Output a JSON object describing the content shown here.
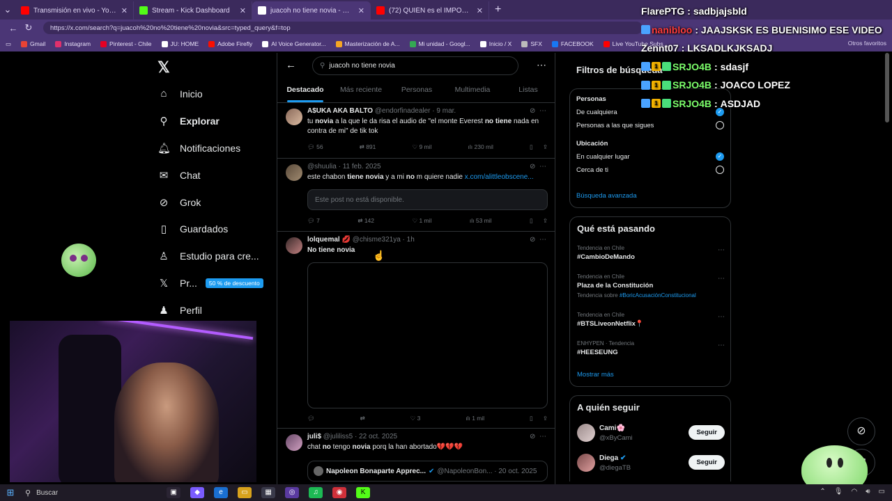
{
  "browser": {
    "tabs": [
      {
        "label": "Transmisión en vivo - YouTube Stu",
        "color": "#ff0000",
        "active": false
      },
      {
        "label": "Stream - Kick Dashboard",
        "color": "#53fc18",
        "active": false
      },
      {
        "label": "juacoh no tiene novia - Buscar / X",
        "color": "#ffffff",
        "active": true
      },
      {
        "label": "(72) QUIÉN es el IMPOSTOR en Mi",
        "color": "#ff0000",
        "active": false
      }
    ],
    "new_tab": "+",
    "url": "https://x.com/search?q=juacoh%20no%20tiene%20novia&src=typed_query&f=top",
    "bookmarks": [
      {
        "label": "Gmail",
        "color": "#ea4335"
      },
      {
        "label": "Instagram",
        "color": "#e1306c"
      },
      {
        "label": "Pinterest - Chile",
        "color": "#e60023"
      },
      {
        "label": "JU: HOME",
        "color": "#ffffff"
      },
      {
        "label": "Adobe Firefly",
        "color": "#fa0f00"
      },
      {
        "label": "AI Voice Generator...",
        "color": "#ffffff"
      },
      {
        "label": "Masterización de A...",
        "color": "#f5a623"
      },
      {
        "label": "Mi unidad - Googl...",
        "color": "#34a853"
      },
      {
        "label": "Inicio / X",
        "color": "#ffffff"
      },
      {
        "label": "SFX",
        "color": "#bbbbbb"
      },
      {
        "label": "FACEBOOK",
        "color": "#1877f2"
      },
      {
        "label": "Live YouTube Subs...",
        "color": "#ff0000"
      }
    ],
    "other_bookmarks": "Otros favoritos"
  },
  "nav": {
    "logo": "𝕏",
    "items": [
      {
        "label": "Inicio",
        "icon": "home-icon",
        "glyph": "⌂",
        "bold": false
      },
      {
        "label": "Explorar",
        "icon": "search-icon",
        "glyph": "⚲",
        "bold": true
      },
      {
        "label": "Notificaciones",
        "icon": "bell-icon",
        "glyph": "🔔︎",
        "bold": false
      },
      {
        "label": "Chat",
        "icon": "mail-icon",
        "glyph": "✉",
        "bold": false
      },
      {
        "label": "Grok",
        "icon": "grok-icon",
        "glyph": "⊘",
        "bold": false
      },
      {
        "label": "Guardados",
        "icon": "bookmark-icon",
        "glyph": "▯",
        "bold": false
      },
      {
        "label": "Estudio para cre...",
        "icon": "studio-icon",
        "glyph": "♙",
        "bold": false
      },
      {
        "label": "Pr...",
        "icon": "x-premium-icon",
        "glyph": "𝕏",
        "bold": false
      },
      {
        "label": "Perfil",
        "icon": "profile-icon",
        "glyph": "♟",
        "bold": false
      }
    ],
    "premium_badge": "50 % de descuento"
  },
  "search": {
    "query": "juacoh no tiene novia",
    "tabs": [
      "Destacado",
      "Más reciente",
      "Personas",
      "Multimedia",
      "Listas"
    ]
  },
  "posts": [
    {
      "name": "A$UKA AKA BALTO",
      "handle": "@endorfinadealer · 9 mar.",
      "text_parts": [
        "tu ",
        "novia",
        " a la que le da risa el audio de \"el monte Everest ",
        "no tiene",
        " nada en contra de mi\" de tik tok"
      ],
      "replies": "56",
      "reposts": "891",
      "likes": "9 mil",
      "views": "230 mil"
    },
    {
      "name": "",
      "handle": "@shuulia · 11 feb. 2025",
      "text_parts": [
        "este chabon ",
        "tiene novia",
        " y a mi ",
        "no",
        " m quiere nadie "
      ],
      "link": "x.com/alittleobscene...",
      "unavailable": "Este post no está disponible.",
      "replies": "7",
      "reposts": "142",
      "likes": "1 mil",
      "views": "53 mil"
    },
    {
      "name": "lolquemal 💋",
      "handle": "@chisme321ya · 1h",
      "text": "No tiene novia",
      "replies": "",
      "reposts": "",
      "likes": "3",
      "views": "1 mil"
    },
    {
      "name": "juli$",
      "handle": "@juliliss5 · 22 oct. 2025",
      "text_parts": [
        "chat ",
        "no",
        " tengo ",
        "novia",
        " porq la han abortado💔💔💔"
      ],
      "quote_name": "Napoleon Bonaparte Apprec...",
      "quote_handle": "@NapoleonBon... · 20 oct. 2025"
    }
  ],
  "filters": {
    "title": "Filtros de búsqueda",
    "people_label": "Personas",
    "people_options": [
      "De cualquiera",
      "Personas a las que sigues"
    ],
    "location_label": "Ubicación",
    "location_options": [
      "En cualquier lugar",
      "Cerca de ti"
    ],
    "advanced": "Búsqueda avanzada"
  },
  "trends": {
    "title": "Qué está pasando",
    "items": [
      {
        "meta": "Tendencia en Chile",
        "name": "#CambioDeMando",
        "sub": ""
      },
      {
        "meta": "Tendencia en Chile",
        "name": "Plaza de la Constitución",
        "sub": "Tendencia sobre ",
        "sub_link": "#BoricAcusaciónConstitucional"
      },
      {
        "meta": "Tendencia en Chile",
        "name": "#BTSLiveonNetflix📍",
        "sub": ""
      },
      {
        "meta": "ENHYPEN · Tendencia",
        "name": "#HEESEUNG",
        "sub": ""
      }
    ],
    "more": "Mostrar más"
  },
  "who_to_follow": {
    "title": "A quién seguir",
    "items": [
      {
        "name": "Cami🌸",
        "handle": "@xByCami",
        "button": "Seguir"
      },
      {
        "name": "Diega",
        "handle": "@diegaTB",
        "button": "Seguir"
      }
    ]
  },
  "chat": [
    {
      "user": "FlarePTG",
      "message": "sadbjajsbld",
      "color": "#ffffff",
      "badges": []
    },
    {
      "user": "nanibloo",
      "message": "JAAJSKSK ES BUENISIMO ESE VIDEO",
      "color": "#ff3b3b",
      "badges": [
        "A"
      ]
    },
    {
      "user": "Zennt07",
      "message": "LKSADLKJKSADJ",
      "color": "#ffffff",
      "badges": []
    },
    {
      "user": "SRJO4B",
      "message": "sdasjf",
      "color": "#7cff6b",
      "badges": [
        "A",
        "1",
        "B"
      ]
    },
    {
      "user": "SRJO4B",
      "message": "JOACO LOPEZ",
      "color": "#7cff6b",
      "badges": [
        "A",
        "1",
        "B"
      ]
    },
    {
      "user": "SRJO4B",
      "message": "ASDJAD",
      "color": "#7cff6b",
      "badges": [
        "A",
        "1",
        "B"
      ]
    }
  ],
  "taskbar": {
    "search": "Buscar"
  }
}
